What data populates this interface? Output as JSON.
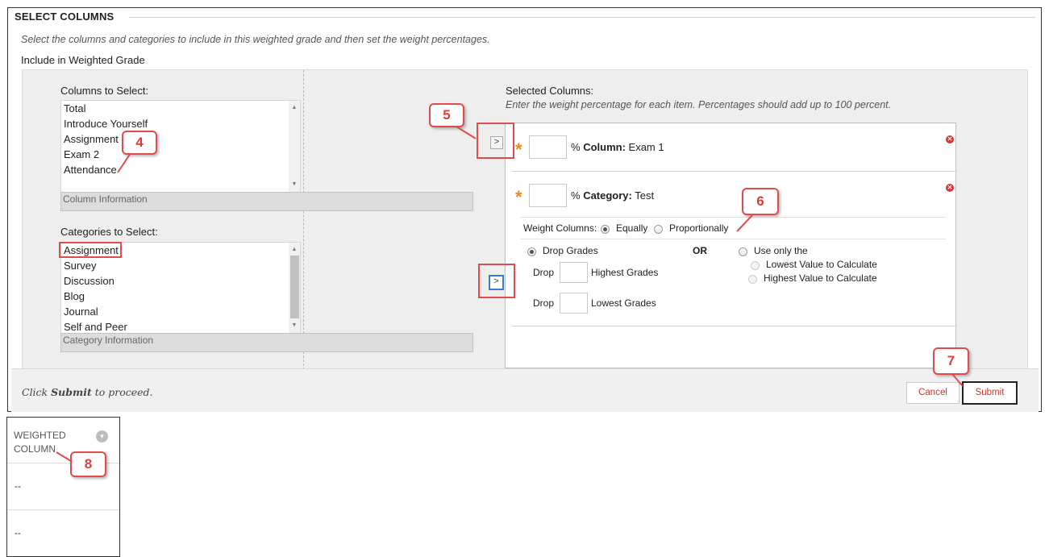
{
  "section": {
    "title": "SELECT COLUMNS",
    "instructions": "Select the columns and categories to include in this weighted grade and then set the weight percentages.",
    "include_label": "Include in Weighted Grade"
  },
  "columns_picker": {
    "label": "Columns to Select:",
    "items": [
      "Total",
      "Introduce Yourself",
      "Assignment",
      "Exam 2",
      "Attendance"
    ],
    "info": "Column Information"
  },
  "categories_picker": {
    "label": "Categories to Select:",
    "items": [
      "Assignment",
      "Survey",
      "Discussion",
      "Blog",
      "Journal",
      "Self and Peer"
    ],
    "info": "Category Information"
  },
  "move_button_glyph": ">",
  "selected": {
    "label": "Selected Columns:",
    "hint": "Enter the weight percentage for each item. Percentages should add up to 100 percent.",
    "required_marker": "*",
    "percent_sign": "%",
    "column_row": {
      "type_label": "Column:",
      "name": "Exam 1",
      "value": ""
    },
    "category_row": {
      "type_label": "Category:",
      "name": "Test",
      "value": "",
      "weight_label": "Weight Columns:",
      "weight_options": [
        "Equally",
        "Proportionally"
      ],
      "weight_selected": "Equally",
      "drop_grades_label": "Drop Grades",
      "drop_word": "Drop",
      "highest_label": "Highest Grades",
      "lowest_label": "Lowest Grades",
      "or_label": "OR",
      "use_only_label": "Use only the",
      "lowest_value_label": "Lowest Value to Calculate",
      "highest_value_label": "Highest Value to Calculate"
    }
  },
  "footer": {
    "click": "Click ",
    "submit_word": "Submit",
    "proceed": " to proceed.",
    "cancel": "Cancel",
    "submit": "Submit"
  },
  "callouts": [
    "4",
    "5",
    "6",
    "7",
    "8"
  ],
  "weighted_column": {
    "header_line1": "WEIGHTED",
    "header_line2": "COLUMN",
    "cells": [
      "--",
      "--"
    ]
  },
  "colors": {
    "callout_red": "#e24b4b",
    "required_orange": "#e58a1f",
    "button_text_red": "#c0392b",
    "panel_grey": "#eeeeee"
  }
}
